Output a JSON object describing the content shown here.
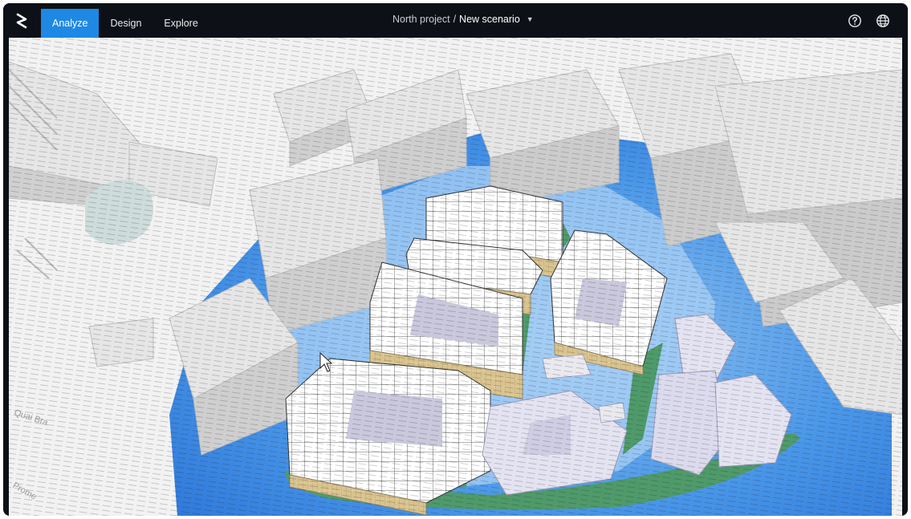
{
  "app": {
    "logo_icon": "brand-logo-icon",
    "accent_color": "#1e88e5"
  },
  "nav": {
    "tabs": [
      {
        "label": "Analyze",
        "active": true
      },
      {
        "label": "Design",
        "active": false
      },
      {
        "label": "Explore",
        "active": false
      }
    ]
  },
  "project": {
    "name": "North project",
    "separator": "/",
    "scenario": "New scenario"
  },
  "toolbar": {
    "help_icon": "help-circle-icon",
    "language_icon": "globe-icon"
  },
  "map": {
    "street_labels": [
      "Quai Bra",
      "Prome"
    ],
    "colors": {
      "flow_blue": "#3b8fe8",
      "flow_light": "#a9d0f5",
      "vegetation": "#4f9a6a",
      "facade": "#d9c38e",
      "existing_building": "#e6e6e6",
      "new_roof": "#ffffff"
    }
  }
}
